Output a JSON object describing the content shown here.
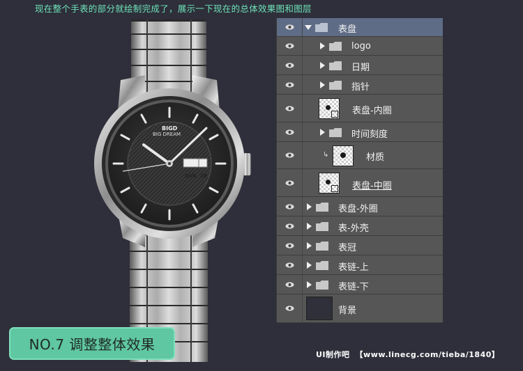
{
  "caption": "现在整个手表的部分就绘制完成了，展示一下现在的总体效果图和图层",
  "watch": {
    "brand": "BIGD",
    "brand_sub": "BIG DREAM",
    "date_day": "SUN",
    "date_num": "18"
  },
  "layers": [
    {
      "label": "表盘",
      "kind": "folder",
      "expanded": true,
      "selected": true
    },
    {
      "label": "logo",
      "kind": "folder",
      "expanded": false
    },
    {
      "label": "日期",
      "kind": "folder",
      "expanded": false
    },
    {
      "label": "指针",
      "kind": "folder",
      "expanded": false
    },
    {
      "label": "表盘-内圈",
      "kind": "layer-mask"
    },
    {
      "label": "时间刻度",
      "kind": "folder",
      "expanded": false
    },
    {
      "label": "材质",
      "kind": "layer-clip"
    },
    {
      "label": "表盘-中圈",
      "kind": "layer-mask"
    },
    {
      "label": "表盘-外圈",
      "kind": "folder",
      "expanded": false
    },
    {
      "label": "表-外壳",
      "kind": "folder",
      "expanded": false
    },
    {
      "label": "表冠",
      "kind": "folder",
      "expanded": false
    },
    {
      "label": "表链-上",
      "kind": "folder",
      "expanded": false
    },
    {
      "label": "表链-下",
      "kind": "folder",
      "expanded": false
    },
    {
      "label": "背景",
      "kind": "background"
    }
  ],
  "step_button": "NO.7 调整整体效果",
  "footer": {
    "brand": "UI制作吧",
    "url": "【www.linecg.com/tieba/1840】"
  },
  "colors": {
    "accent": "#5fc7a1",
    "caption": "#6ee2b8",
    "selected_layer": "#5e6c86",
    "background": "#2e2f3a"
  }
}
